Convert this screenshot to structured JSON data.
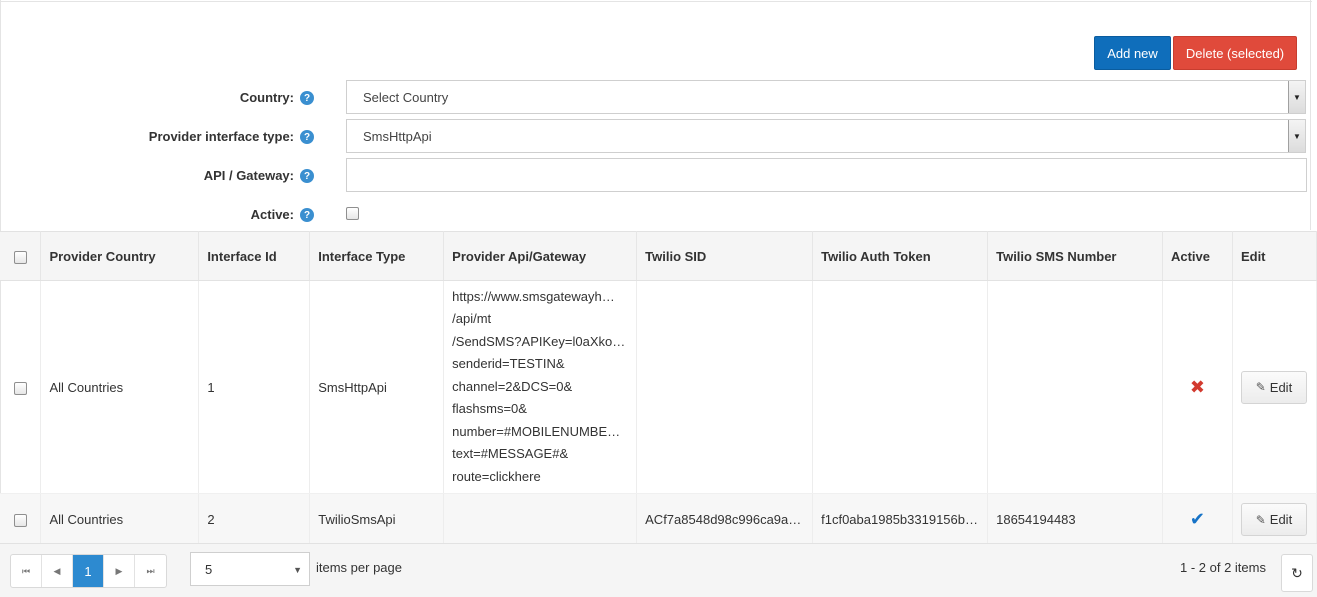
{
  "toolbar": {
    "add_label": "Add new",
    "delete_label": "Delete (selected)"
  },
  "form": {
    "country_label": "Country:",
    "country_value": "Select Country",
    "provider_type_label": "Provider interface type:",
    "provider_type_value": "SmsHttpApi",
    "api_label": "API / Gateway:",
    "api_value": "",
    "active_label": "Active:",
    "help_glyph": "?"
  },
  "table": {
    "headers": [
      "Provider Country",
      "Interface Id",
      "Interface Type",
      "Provider Api/Gateway",
      "Twilio SID",
      "Twilio Auth Token",
      "Twilio SMS Number",
      "Active",
      "Edit"
    ],
    "rows": [
      {
        "country": "All Countries",
        "interface_id": "1",
        "interface_type": "SmsHttpApi",
        "api_lines": [
          "https://www.smsgatewayh…",
          "/api/mt",
          "/SendSMS?APIKey=l0aXkos…",
          "senderid=TESTIN&",
          "channel=2&DCS=0&",
          "flashsms=0&",
          "number=#MOBILENUMBER#&",
          "text=#MESSAGE#&",
          "route=clickhere"
        ],
        "twilio_sid": "",
        "twilio_token": "",
        "twilio_number": "",
        "active": false,
        "edit_label": "Edit"
      },
      {
        "country": "All Countries",
        "interface_id": "2",
        "interface_type": "TwilioSmsApi",
        "api_lines": [],
        "twilio_sid": "ACf7a8548d98c996ca9ac…",
        "twilio_token": "f1cf0aba1985b3319156b…",
        "twilio_number": "18654194483",
        "active": true,
        "edit_label": "Edit"
      }
    ]
  },
  "pager": {
    "current_page": "1",
    "page_size": "5",
    "items_per_page_label": "items per page",
    "summary": "1 - 2 of 2 items"
  },
  "icons": {
    "first": "first-page-icon",
    "prev": "prev-page-icon",
    "next": "next-page-icon",
    "last": "last-page-icon",
    "refresh": "refresh-icon",
    "inactive": "cross-icon",
    "active": "check-icon",
    "edit": "pencil-icon"
  },
  "colors": {
    "add_button": "#0f6ebb",
    "delete_button": "#e04a3b",
    "help_icon": "#3a8fd0",
    "active_page": "#2d8ad0",
    "inactive_mark": "#d23a2f",
    "active_mark": "#1673c7"
  }
}
